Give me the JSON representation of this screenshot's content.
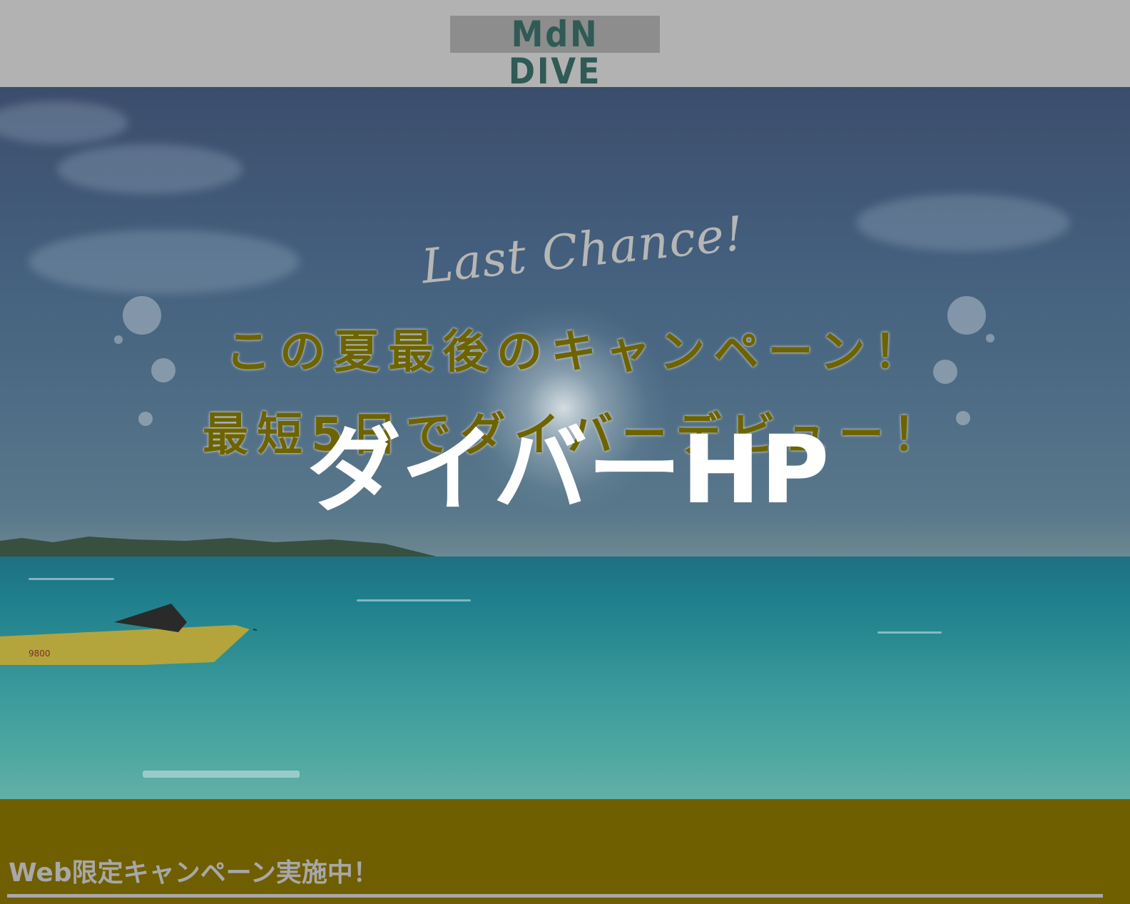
{
  "header": {
    "logo_text": "MdN DIVE"
  },
  "hero": {
    "catch_script": "Last Chance!",
    "headline_line1": "この夏最後のキャンペーン！",
    "headline_line2": "最短5日でダイバーデビュー！",
    "overlay_title": "ダイバーHP",
    "boat_number": "9800"
  },
  "campaign": {
    "title": "Web限定キャンペーン実施中！"
  },
  "colors": {
    "header_bg": "#b2b2b2",
    "logo_text": "#2f5a55",
    "headline": "#6d6400",
    "campaign_bg": "#6f5f00",
    "campaign_text": "#a8a8a8"
  }
}
